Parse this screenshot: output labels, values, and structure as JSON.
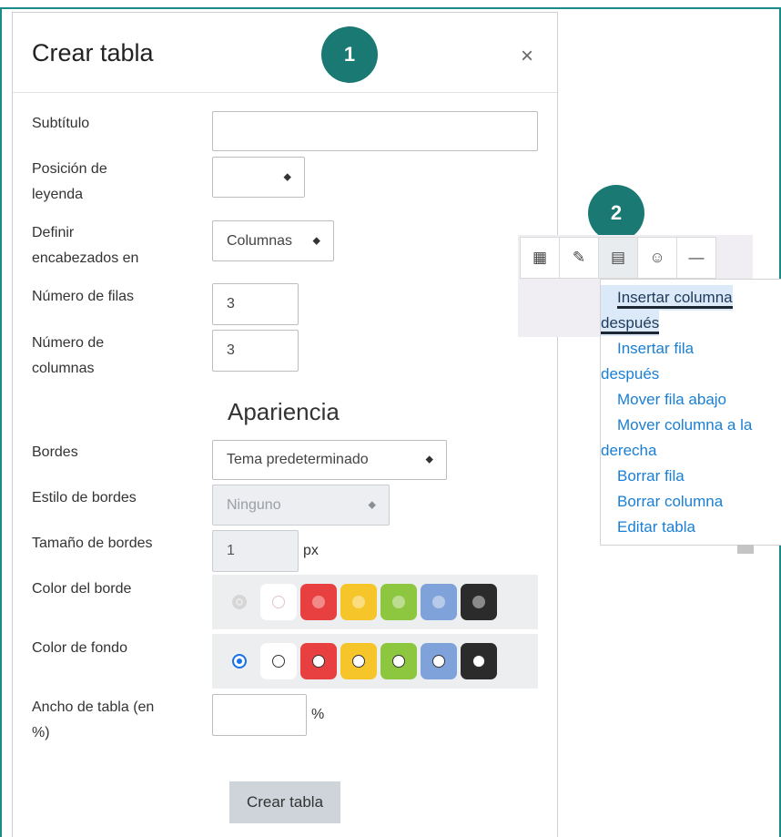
{
  "dialog": {
    "title": "Crear tabla",
    "close_label": "×",
    "badge1": "1",
    "badge2": "2",
    "fields": {
      "subtitle_label": "Subtítulo",
      "caption_pos_label_1": "Posición de",
      "caption_pos_label_2": "leyenda",
      "headers_label_1": "Definir",
      "headers_label_2": "encabezados en",
      "headers_value": "Columnas",
      "rows_label": "Número de filas",
      "rows_value": "3",
      "cols_label_1": "Número de",
      "cols_label_2": "columnas",
      "cols_value": "3"
    },
    "appearance": {
      "title": "Apariencia",
      "borders_label": "Bordes",
      "borders_value": "Tema predeterminado",
      "border_style_label": "Estilo de bordes",
      "border_style_value": "Ninguno",
      "border_size_label": "Tamaño de bordes",
      "border_size_value": "1",
      "border_size_unit": "px",
      "border_color_label": "Color del borde",
      "bg_color_label": "Color de fondo",
      "width_label_1": "Ancho de tabla (en",
      "width_label_2": "%)",
      "width_unit": "%"
    },
    "submit_label": "Crear tabla"
  },
  "colors": {
    "swatches": [
      "#ffffff",
      "#e84040",
      "#f5c52a",
      "#8dc63f",
      "#7ea2d9",
      "#2b2b2b"
    ],
    "accent_teal": "#1a7a73",
    "link_blue": "#1a7fd4"
  },
  "toolbar": {
    "buttons": [
      "calculator-icon",
      "edit-icon",
      "table-icon",
      "smiley-icon",
      "horizontal-rule-icon"
    ],
    "glyphs": [
      "▦",
      "✎",
      "▤",
      "☺",
      "—"
    ]
  },
  "menu": {
    "items": [
      {
        "line1": "Insertar columna",
        "line2": "después"
      },
      {
        "line1": "Insertar fila",
        "line2": "después"
      },
      {
        "line1": "Mover fila abajo"
      },
      {
        "line1": "Mover columna a la",
        "line2": "derecha"
      },
      {
        "line1": "Borrar fila"
      },
      {
        "line1": "Borrar columna"
      },
      {
        "line1": "Editar tabla"
      }
    ]
  }
}
